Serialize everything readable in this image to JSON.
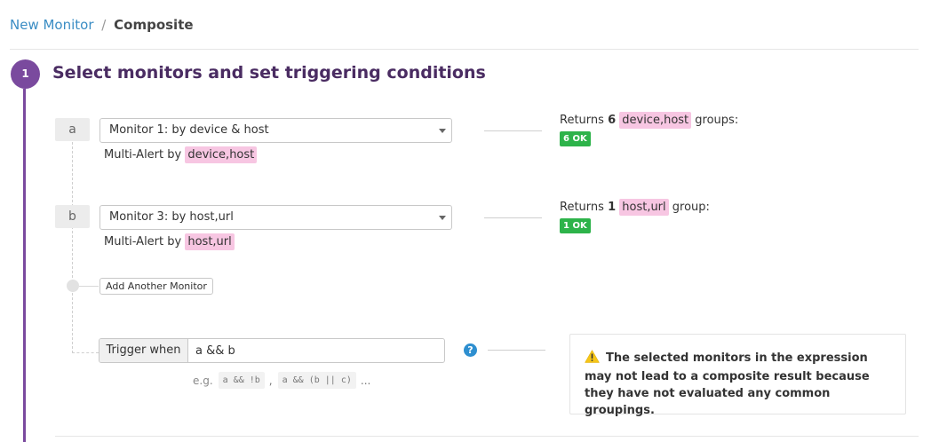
{
  "breadcrumb": {
    "parent": "New Monitor",
    "separator": "/",
    "current": "Composite"
  },
  "step": {
    "number": "1",
    "title": "Select monitors and set triggering conditions"
  },
  "monitors": [
    {
      "letter": "a",
      "selected": "Monitor 1: by device & host",
      "multi_alert_label": "Multi-Alert by",
      "multi_alert_tag": "device,host",
      "returns_prefix": "Returns",
      "returns_count": "6",
      "returns_tag": "device,host",
      "returns_suffix": "groups:",
      "status": "6 OK"
    },
    {
      "letter": "b",
      "selected": "Monitor 3: by host,url",
      "multi_alert_label": "Multi-Alert by",
      "multi_alert_tag": "host,url",
      "returns_prefix": "Returns",
      "returns_count": "1",
      "returns_tag": "host,url",
      "returns_suffix": "group:",
      "status": "1 OK"
    }
  ],
  "add_monitor_label": "Add Another Monitor",
  "trigger": {
    "label": "Trigger when",
    "value": "a && b",
    "example_prefix": "e.g.",
    "examples": [
      "a && !b",
      "a && (b || c)"
    ],
    "comma": ",",
    "ellipsis": "..."
  },
  "help_icon": "?",
  "warning": {
    "icon": "warning-triangle-icon",
    "text": "The selected monitors in the expression may not lead to a composite result because they have not evaluated any common groupings."
  },
  "colors": {
    "accent_purple": "#7a4a9e",
    "title_purple": "#4a2c62",
    "tag_pink": "#f7c6e2",
    "ok_green": "#2db34a",
    "link_blue": "#3b8dc4",
    "warning_yellow": "#f5c518"
  }
}
